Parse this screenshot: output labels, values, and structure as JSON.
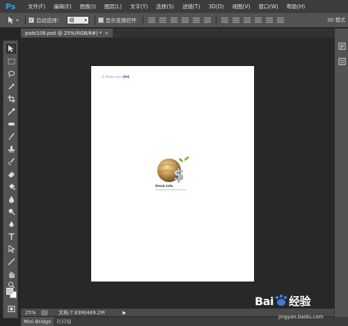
{
  "app": {
    "logo": "Ps"
  },
  "menu": [
    "文件(F)",
    "编辑(E)",
    "图像(I)",
    "图层(L)",
    "文字(Y)",
    "选择(S)",
    "滤镜(T)",
    "3D(D)",
    "视图(V)",
    "窗口(W)",
    "帮助(H)"
  ],
  "options": {
    "auto_select_label": "自动选择：",
    "auto_select_checked": true,
    "auto_select_value": "组",
    "show_transform_label": "显示变换控件",
    "show_transform_checked": false,
    "mode_3d_label": "3D 模式"
  },
  "document_tab": {
    "label": "psds108.psd @ 25%(RGB/8#) *",
    "close": "×"
  },
  "document": {
    "header_light": "E Photo icon ",
    "header_bold": "004",
    "emblem_title": "Stock info"
  },
  "status": {
    "zoom": "25%",
    "docinfo": "文档:7.83M/449.2M"
  },
  "bottom_tabs": [
    "Mini Bridge",
    "时间轴"
  ],
  "watermark": {
    "brand_pre": "Bai",
    "brand_post": "经验",
    "url": "jingyan.baidu.com"
  },
  "colors": {
    "accent": "#2fa3e0",
    "canvas_bg": "#282828",
    "panel": "#535353",
    "doc_bg": "#ffffff"
  }
}
